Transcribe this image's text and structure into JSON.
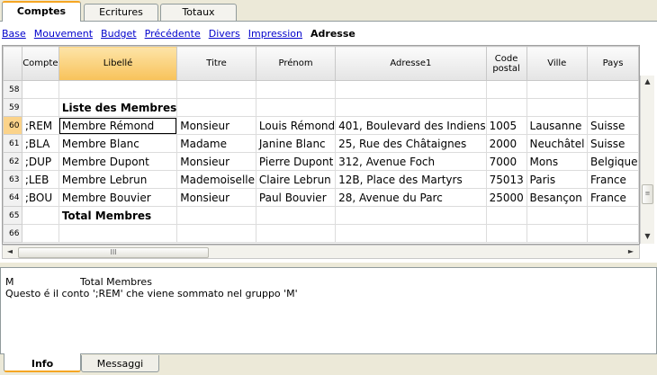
{
  "tabs": [
    "Comptes",
    "Ecritures",
    "Totaux"
  ],
  "views": {
    "links": [
      "Base",
      "Mouvement",
      "Budget",
      "Précédente",
      "Divers",
      "Impression"
    ],
    "current": "Adresse"
  },
  "table": {
    "headers": [
      "Compte",
      "Libellé",
      "Titre",
      "Prénom",
      "Adresse1",
      "Code postal",
      "Ville",
      "Pays"
    ],
    "rows": [
      {
        "num": "58",
        "cells": [
          "",
          "",
          "",
          "",
          "",
          "",
          "",
          ""
        ]
      },
      {
        "num": "59",
        "cells": [
          "",
          "Liste des Membres",
          "",
          "",
          "",
          "",
          "",
          ""
        ]
      },
      {
        "num": "60",
        "cells": [
          ";REM",
          "Membre Rémond",
          "Monsieur",
          "Louis Rémond",
          "401, Boulevard des Indiens",
          "1005",
          "Lausanne",
          "Suisse"
        ]
      },
      {
        "num": "61",
        "cells": [
          ";BLA",
          "Membre Blanc",
          "Madame",
          "Janine Blanc",
          "25, Rue des Châtaignes",
          "2000",
          "Neuchâtel",
          "Suisse"
        ]
      },
      {
        "num": "62",
        "cells": [
          ";DUP",
          "Membre Dupont",
          "Monsieur",
          "Pierre Dupont",
          "312, Avenue Foch",
          "7000",
          "Mons",
          "Belgique"
        ]
      },
      {
        "num": "63",
        "cells": [
          ";LEB",
          "Membre Lebrun",
          "Mademoiselle",
          "Claire Lebrun",
          "12B, Place des Martyrs",
          "75013",
          "Paris",
          "France"
        ]
      },
      {
        "num": "64",
        "cells": [
          ";BOU",
          "Membre Bouvier",
          "Monsieur",
          "Paul Bouvier",
          "28, Avenue du Parc",
          "25000",
          "Besançon",
          "France"
        ]
      },
      {
        "num": "65",
        "cells": [
          "",
          "Total Membres",
          "",
          "",
          "",
          "",
          "",
          ""
        ]
      },
      {
        "num": "66",
        "cells": [
          "",
          "",
          "",
          "",
          "",
          "",
          "",
          ""
        ]
      }
    ]
  },
  "info": {
    "line1_code": "M",
    "line1_label": "Total Membres",
    "line2": "Questo é il conto ';REM' che viene sommato nel gruppo 'M'"
  },
  "bottom_tabs": [
    "Info",
    "Messaggi"
  ],
  "scroll": {
    "left": "◄",
    "right": "►",
    "up": "▲",
    "down": "▼",
    "grip_h": "III",
    "grip_v": "≡"
  }
}
